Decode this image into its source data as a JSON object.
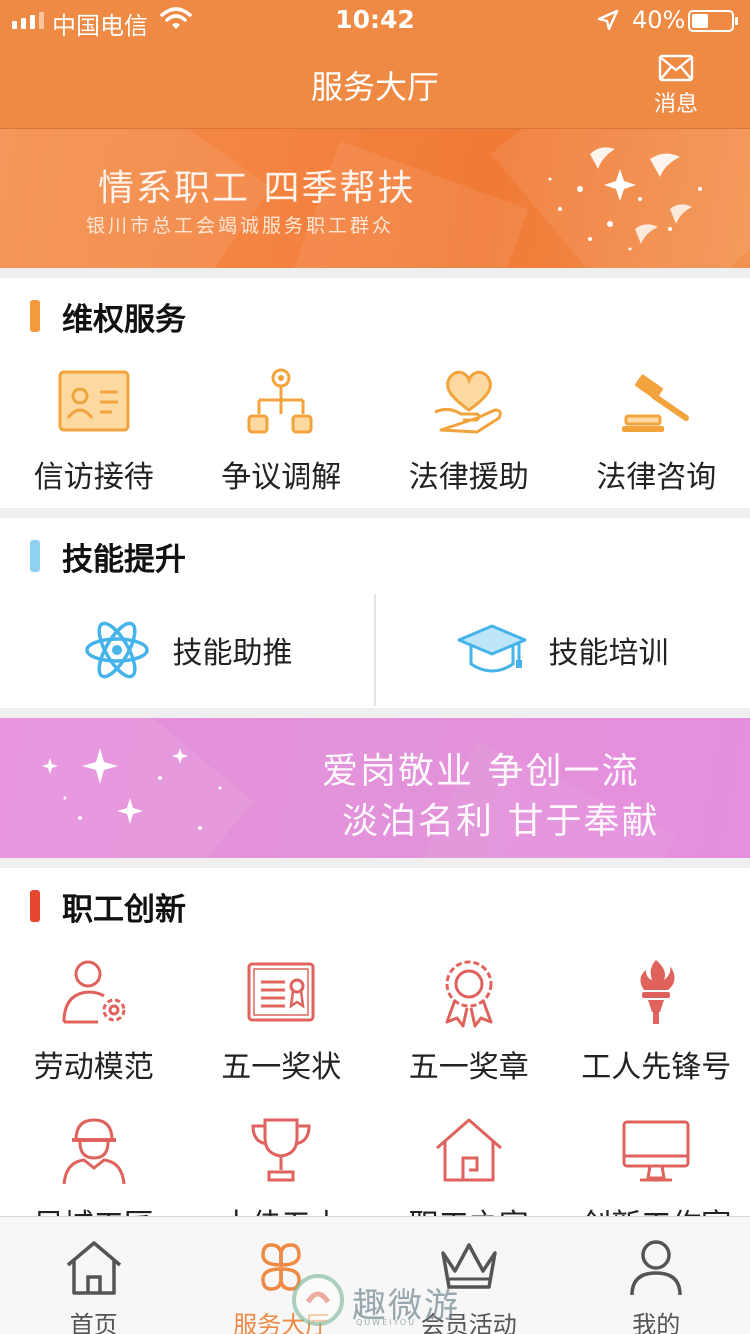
{
  "status_bar": {
    "carrier": "中国电信",
    "time": "10:42",
    "battery": "40%"
  },
  "nav": {
    "title": "服务大厅",
    "message_label": "消息"
  },
  "banner_top": {
    "line1": "情系职工 四季帮扶",
    "line2": "银川市总工会竭诚服务职工群众"
  },
  "rights": {
    "title": "维权服务",
    "accent": "#f39a3a",
    "items": [
      {
        "label": "信访接待",
        "icon": "id-card-icon"
      },
      {
        "label": "争议调解",
        "icon": "org-chart-icon"
      },
      {
        "label": "法律援助",
        "icon": "heart-hand-icon"
      },
      {
        "label": "法律咨询",
        "icon": "gavel-icon"
      }
    ]
  },
  "skills": {
    "title": "技能提升",
    "accent": "#8fd0f3",
    "items": [
      {
        "label": "技能助推",
        "icon": "atom-icon"
      },
      {
        "label": "技能培训",
        "icon": "graduation-cap-icon"
      }
    ]
  },
  "banner_mid": {
    "line1": "爱岗敬业 争创一流",
    "line2": "淡泊名利 甘于奉献"
  },
  "innovation": {
    "title": "职工创新",
    "accent": "#e8452f",
    "row1": [
      {
        "label": "劳动模范",
        "icon": "person-gear-icon"
      },
      {
        "label": "五一奖状",
        "icon": "certificate-icon"
      },
      {
        "label": "五一奖章",
        "icon": "medal-icon"
      },
      {
        "label": "工人先锋号",
        "icon": "torch-icon"
      }
    ],
    "row2": [
      {
        "label": "凤城工匠",
        "icon": "worker-helmet-icon"
      },
      {
        "label": "十佳五小",
        "icon": "trophy-icon"
      },
      {
        "label": "职工之家",
        "icon": "house-icon"
      },
      {
        "label": "创新工作室",
        "icon": "monitor-icon"
      }
    ]
  },
  "tabbar": {
    "items": [
      {
        "label": "首页",
        "icon": "home-icon"
      },
      {
        "label": "服务大厅",
        "icon": "clover-icon"
      },
      {
        "label": "会员活动",
        "icon": "crown-icon"
      },
      {
        "label": "我的",
        "icon": "user-icon"
      }
    ],
    "active_color": "#ef8a44"
  },
  "watermark": {
    "text": "趣微游",
    "sub": "QUWEIYOU"
  }
}
